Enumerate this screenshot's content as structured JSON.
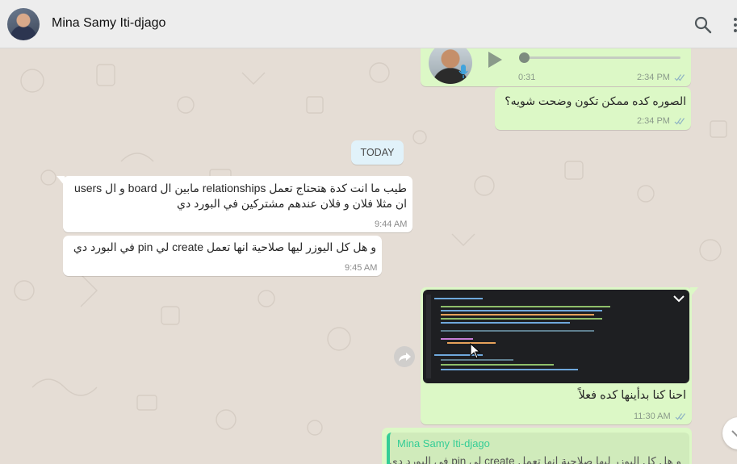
{
  "header": {
    "contact_name": "Mina Samy Iti-djago",
    "avatar_icon": "user-avatar",
    "search_icon": "search-icon",
    "menu_icon": "more-vertical-icon"
  },
  "colors": {
    "outgoing_bubble": "#dcf8c6",
    "incoming_bubble": "#ffffff",
    "chat_background": "#e5ddd5",
    "date_chip": "#e1f2fa",
    "quote_accent": "#35cd96"
  },
  "messages": {
    "voice": {
      "duration": "0:31",
      "time": "2:34 PM",
      "status": "read"
    },
    "photo_question": {
      "text": "الصوره كده ممكن تكون وضحت شويه؟",
      "time": "2:34 PM",
      "status": "read"
    },
    "date_divider": "TODAY",
    "incoming_1": {
      "line1": "طيب ما انت كدة هتحتاج تعمل relationships مابين ال board و ال users",
      "line2": "ان مثلا فلان و فلان عندهم مشتركين في البورد دي",
      "time": "9:44 AM"
    },
    "incoming_2": {
      "text": "و هل كل اليوزر ليها صلاحية انها تعمل create لي pin في البورد دي",
      "time": "9:45 AM"
    },
    "image_msg": {
      "caption": "احنا كنا بدأينها كده فعلاً",
      "time": "11:30 AM",
      "status": "read"
    },
    "reply_msg": {
      "quoted_author": "Mina Samy Iti-djago",
      "quoted_text": "و هل كل اليوزر ليها صلاحية انها تعمل create لي pin في البورد دي"
    }
  }
}
